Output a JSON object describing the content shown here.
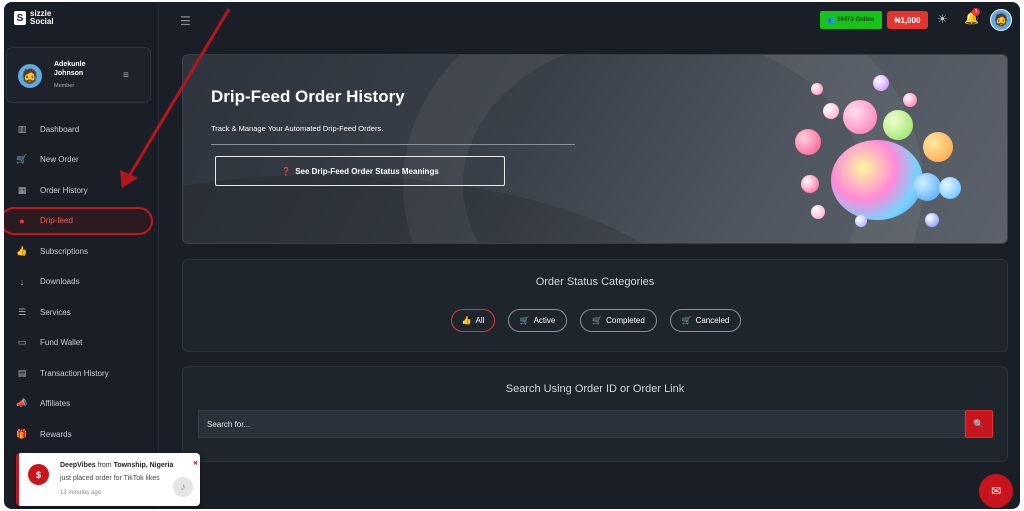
{
  "brand": {
    "line1": "sizzle",
    "line2": "Social",
    "mark": "S"
  },
  "user": {
    "name": "Adekunle Johnson",
    "role": "Member"
  },
  "sidebar": {
    "items": [
      {
        "label": "Dashboard",
        "icon": "chart-icon",
        "glyph": "▥"
      },
      {
        "label": "New Order",
        "icon": "cart-icon",
        "glyph": "🛒"
      },
      {
        "label": "Order History",
        "icon": "calendar-icon",
        "glyph": "▦"
      },
      {
        "label": "Drip-feed",
        "icon": "drip-icon",
        "glyph": "●"
      },
      {
        "label": "Subscriptions",
        "icon": "thumbs-up-icon",
        "glyph": "👍"
      },
      {
        "label": "Downloads",
        "icon": "download-icon",
        "glyph": "↓"
      },
      {
        "label": "Services",
        "icon": "list-icon",
        "glyph": "☰"
      },
      {
        "label": "Fund Wallet",
        "icon": "wallet-icon",
        "glyph": "▭"
      },
      {
        "label": "Transaction History",
        "icon": "file-icon",
        "glyph": "▤"
      },
      {
        "label": "Affiliates",
        "icon": "bullhorn-icon",
        "glyph": "📣"
      },
      {
        "label": "Rewards",
        "icon": "gift-icon",
        "glyph": "🎁"
      }
    ]
  },
  "topbar": {
    "online": "26473 Online",
    "balance": "₦1,000",
    "notifications": "1"
  },
  "hero": {
    "title": "Drip-Feed Order History",
    "subtitle": "Track & Manage Your Automated Drip-Feed Orders.",
    "button": "See Drip-Feed Order Status Meanings"
  },
  "status": {
    "title": "Order Status Categories",
    "filters": [
      "All",
      "Active",
      "Completed",
      "Canceled"
    ]
  },
  "search": {
    "title": "Search Using Order ID or Order Link",
    "placeholder": "Search for..."
  },
  "toast": {
    "name": "DeepVibes",
    "from": "from",
    "location": "Township, Nigeria",
    "message": "just placed order for TikTok likes",
    "time": "13 minutes ago"
  },
  "colors": {
    "accent": "#c8141c",
    "online": "#18c21a",
    "background": "#1a1f27"
  }
}
